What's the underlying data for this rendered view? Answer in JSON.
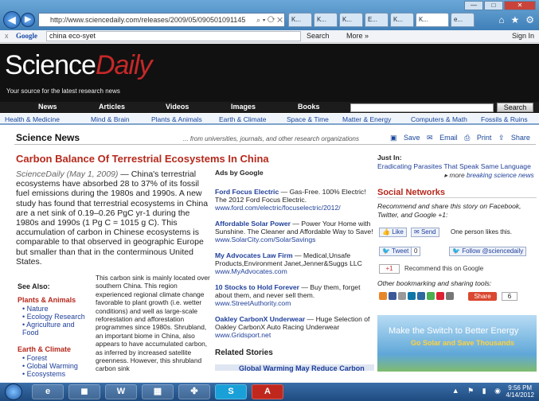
{
  "browser": {
    "url": "http://www.sciencedaily.com/releases/2009/05/090501091145",
    "tabs": [
      "K...",
      "K...",
      "K...",
      "E...",
      "K...",
      "K...",
      "e..."
    ],
    "window_buttons": [
      "—",
      "□",
      "✕"
    ]
  },
  "google_bar": {
    "close": "x",
    "logo": "Google",
    "query": "china eco-syet",
    "search_label": "Search",
    "more_label": "More »",
    "signin_label": "Sign In"
  },
  "site": {
    "logo_main": "Science",
    "logo_accent": "Daily",
    "tagline": "Your source for the latest research news"
  },
  "menu": {
    "items": [
      "News",
      "Articles",
      "Videos",
      "Images",
      "Books"
    ],
    "search_button": "Search"
  },
  "subnav": [
    "Health & Medicine",
    "Mind & Brain",
    "Plants & Animals",
    "Earth & Climate",
    "Space & Time",
    "Matter & Energy",
    "Computers & Math",
    "Fossils & Ruins"
  ],
  "page": {
    "section_title": "Science News",
    "section_tagline": "... from universities, journals, and other research organizations",
    "tools": [
      "Save",
      "Email",
      "Print",
      "Share"
    ],
    "headline": "Carbon Balance Of Terrestrial Ecosystems In China",
    "dateline": "ScienceDaily (May 1, 2009)",
    "lead": " — China's terrestrial ecosystems have absorbed 28 to 37% of its fossil fuel emissions during the 1980s and 1990s. A new study has found that terrestrial ecosystems in China are a net sink of 0.19–0.26 PgC yr-1 during the 1980s and 1990s (1 Pg C = 1015 g C). This accumulation of carbon in Chinese ecosystems is comparable to that observed in geographic Europe but smaller than that in the conterminous United States.",
    "sink_text": "This carbon sink is mainly located over southern China. This region experienced regional climate change favorable to plant growth (i.e. wetter conditions) and well as large-scale reforestation and afforestation programmes since 1980s. Shrubland, an important biome in China, also appears to have accumulated carbon, as inferred by increased satellite greenness. However, this shrubland carbon sink"
  },
  "see_also": {
    "title": "See Also:",
    "cat1": "Plants & Animals",
    "cat1_items": [
      "Nature",
      "Ecology Research",
      "Agriculture and Food"
    ],
    "cat2": "Earth & Climate",
    "cat2_items": [
      "Forest",
      "Global Warming",
      "Ecosystems"
    ]
  },
  "ads": {
    "header": "Ads by Google",
    "items": [
      {
        "title": "Ford Focus Electric",
        "text": " — Gas-Free. 100% Electric! The 2012 Ford Focus Electric.",
        "url": "www.ford.com/electric/focuselectric/2012/"
      },
      {
        "title": "Affordable Solar Power",
        "text": " — Power Your Home with Sunshine. The Cleaner and Affordable Way to Save!",
        "url": "www.SolarCity.com/SolarSavings"
      },
      {
        "title": "My Advocates Law Firm",
        "text": " — Medical,Unsafe Products,Environment Janet,Jenner&Suggs LLC",
        "url": "www.MyAdvocates.com"
      },
      {
        "title": "10 Stocks to Hold Forever",
        "text": " — Buy them, forget about them, and never sell them.",
        "url": "www.StreetAuthority.com"
      },
      {
        "title": "Oakley CarbonX Underwear",
        "text": " — Huge Selection of Oakley CarbonX Auto Racing Underwear",
        "url": "www.Gridsport.net"
      }
    ],
    "related_title": "Related Stories",
    "related_item": "Global Warming May Reduce Carbon"
  },
  "sidebar": {
    "just_in_label": "Just In:",
    "just_in_link": "Eradicating Parasites That Speak Same Language",
    "more_prefix": "more",
    "more_link": "breaking science news",
    "social_title": "Social Networks",
    "recommend_text": "Recommend and share this story on Facebook, Twitter, and Google +1:",
    "like": "Like",
    "send": "Send",
    "fb_text": "One person likes this.",
    "tweet": "Tweet",
    "tweet_count": "0",
    "follow": "Follow @sciencedaily",
    "gplus": "+1",
    "gplus_text": "Recommend this on Google",
    "other_tools": "Other bookmarking and sharing tools:",
    "share_label": "Share",
    "share_count": "6",
    "banner_line1": "Make the Switch to Better Energy",
    "banner_line2": "Go Solar and Save Thousands"
  },
  "taskbar": {
    "time": "9:56 PM",
    "date": "4/14/2012",
    "apps": [
      "e",
      "◼",
      "W",
      "▦",
      "✤",
      "S",
      "A"
    ]
  }
}
